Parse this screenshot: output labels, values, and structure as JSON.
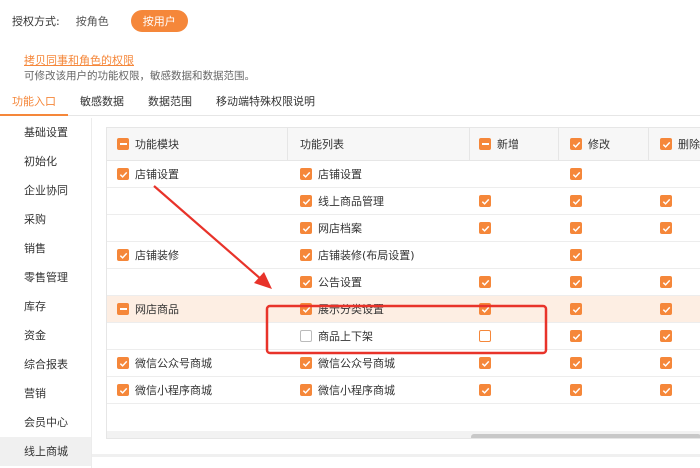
{
  "auth": {
    "label": "授权方式:",
    "option_role": "按角色",
    "option_user": "按用户"
  },
  "copy": {
    "link": "拷贝同事和角色的权限",
    "desc": "可修改该用户的功能权限，敏感数据和数据范围。"
  },
  "tabs": [
    {
      "label": "功能入口",
      "active": true
    },
    {
      "label": "敏感数据",
      "active": false
    },
    {
      "label": "数据范围",
      "active": false
    },
    {
      "label": "移动端特殊权限说明",
      "active": false
    }
  ],
  "sidebar": [
    "基础设置",
    "初始化",
    "企业协同",
    "采购",
    "销售",
    "零售管理",
    "库存",
    "资金",
    "综合报表",
    "营销",
    "会员中心",
    "线上商城"
  ],
  "table": {
    "headers": {
      "module": "功能模块",
      "list": "功能列表",
      "add": "新增",
      "edit": "修改",
      "delete": "删除"
    },
    "rows": [
      {
        "module": "店铺设置",
        "module_cb": "checked",
        "item": "店铺设置",
        "item_cb": "checked",
        "add": "none",
        "edit": "checked",
        "del": "none",
        "highlight": false
      },
      {
        "module": "",
        "module_cb": "none",
        "item": "线上商品管理",
        "item_cb": "checked",
        "add": "checked",
        "edit": "checked",
        "del": "checked",
        "highlight": false
      },
      {
        "module": "",
        "module_cb": "none",
        "item": "网店档案",
        "item_cb": "checked",
        "add": "checked",
        "edit": "checked",
        "del": "checked",
        "highlight": false
      },
      {
        "module": "店铺装修",
        "module_cb": "checked",
        "item": "店铺装修(布局设置)",
        "item_cb": "checked",
        "add": "none",
        "edit": "checked",
        "del": "none",
        "highlight": false
      },
      {
        "module": "",
        "module_cb": "none",
        "item": "公告设置",
        "item_cb": "checked",
        "add": "checked",
        "edit": "checked",
        "del": "checked",
        "highlight": false
      },
      {
        "module": "网店商品",
        "module_cb": "minus",
        "item": "展示分类设置",
        "item_cb": "checked",
        "add": "checked",
        "edit": "checked",
        "del": "checked",
        "highlight": true
      },
      {
        "module": "",
        "module_cb": "none",
        "item": "商品上下架",
        "item_cb": "empty-grey",
        "add": "empty",
        "edit": "checked",
        "del": "checked",
        "highlight": false
      },
      {
        "module": "微信公众号商城",
        "module_cb": "checked",
        "item": "微信公众号商城",
        "item_cb": "checked",
        "add": "checked",
        "edit": "checked",
        "del": "checked",
        "highlight": false
      },
      {
        "module": "微信小程序商城",
        "module_cb": "checked",
        "item": "微信小程序商城",
        "item_cb": "checked",
        "add": "checked",
        "edit": "checked",
        "del": "checked",
        "highlight": false
      }
    ]
  },
  "colors": {
    "accent": "#f5873a",
    "annotation_red": "#e8332a"
  }
}
